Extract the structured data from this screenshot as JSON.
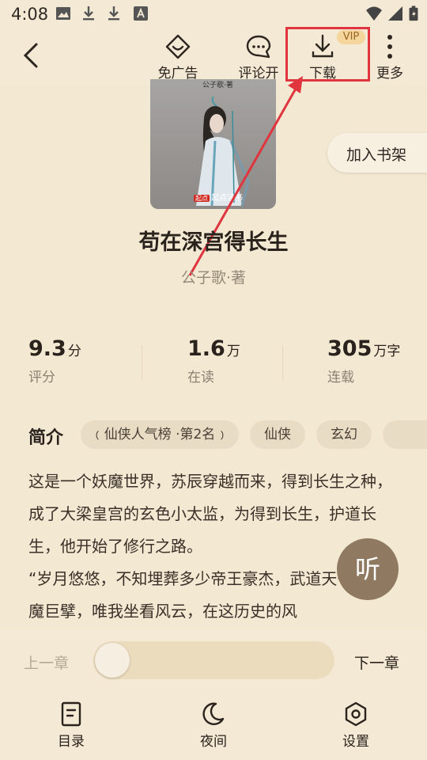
{
  "status_bar": {
    "time": "4:08",
    "icons": [
      "image-icon",
      "download-icon",
      "download-icon",
      "font-icon",
      "wifi-icon",
      "signal-icon",
      "battery-icon"
    ]
  },
  "top_bar": {
    "back_icon": "chevron-left-icon",
    "actions": [
      {
        "label": "免广告",
        "icon": "no-ads-icon"
      },
      {
        "label": "评论开",
        "icon": "comment-icon"
      },
      {
        "label": "下载",
        "icon": "download-icon",
        "badge": "VIP"
      },
      {
        "label": "更多",
        "icon": "more-vertical-icon"
      }
    ],
    "highlight_color": "#e0353f"
  },
  "book": {
    "cover": {
      "author_text": "公子歌·著",
      "publisher": "起点读书",
      "publisher_badge": "起点"
    },
    "add_to_shelf": "加入书架",
    "title": "苟在深宫得长生",
    "author": "公子歌·著",
    "stats": [
      {
        "value": "9.3",
        "unit": "分",
        "caption": "评分"
      },
      {
        "value": "1.6",
        "unit": "万",
        "caption": "在读"
      },
      {
        "value": "305",
        "unit": "万字",
        "caption": "连载"
      }
    ],
    "intro_label": "简介",
    "tags": [
      "仙侠人气榜 ·第2名",
      "仙侠",
      "玄幻"
    ],
    "description": [
      "这是一个妖魔世界，苏辰穿越而来，得到长生之种，成了大梁皇宫的玄色小太监，为得到长生，护道长生，他开始了修行之路。",
      "“岁月悠悠，不知埋葬多少帝王豪杰，武道天子，仙魔巨擘，唯我坐看风云，在这历史的风"
    ],
    "listen_label": "听"
  },
  "reader_bar": {
    "prev_chapter": "上一章",
    "next_chapter": "下一章",
    "progress": 0,
    "nav": [
      {
        "label": "目录",
        "icon": "catalog-icon"
      },
      {
        "label": "夜间",
        "icon": "moon-icon"
      },
      {
        "label": "设置",
        "icon": "settings-icon"
      }
    ]
  },
  "colors": {
    "background": "#f3e8d2",
    "accent": "#8f7961",
    "vip_badge": "#f4d59b"
  }
}
